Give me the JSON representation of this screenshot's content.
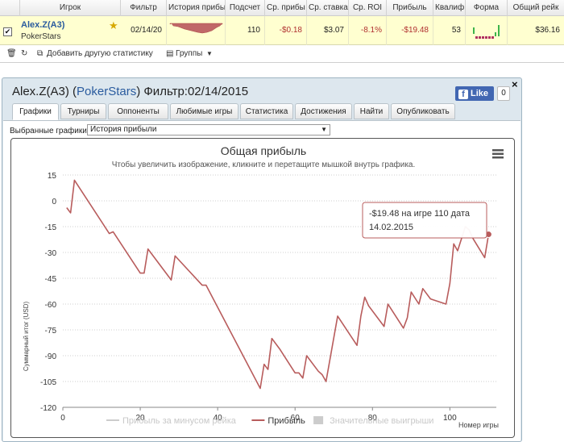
{
  "table": {
    "headers": [
      "Игрок",
      "Фильтр",
      "История прибыл",
      "Подсчет",
      "Ср. прибы",
      "Ср. ставка",
      "Ср. ROI",
      "Прибыль",
      "Квалиф",
      "Форма",
      "Общий рейк"
    ],
    "row": {
      "checked": "✔",
      "player": "Alex.Z(A3)",
      "site": "PokerStars",
      "filter": "02/14/20",
      "count": "110",
      "avg_profit": "-$0.18",
      "avg_stake": "$3.07",
      "avg_roi": "-8.1%",
      "profit": "-$19.48",
      "qual": "53",
      "total_rake": "$36.16"
    },
    "toolbar": {
      "add_stats": "Добавить другую статистику",
      "groups": "Группы"
    }
  },
  "popup": {
    "title_player": "Alex.Z(A3)",
    "title_site": "PokerStars",
    "title_filter": "Фильтр:02/14/2015",
    "fb_like": "Like",
    "fb_count": "0",
    "close": "×",
    "tabs": [
      "Графики",
      "Турниры",
      "Оппоненты",
      "Любимые игры",
      "Статистика",
      "Достижения",
      "Найти",
      "Опубликовать"
    ],
    "active_tab": 0,
    "selected_label": "Выбранные графики:",
    "selected_value": "История прибыли"
  },
  "chart_data": {
    "type": "line",
    "title": "Общая прибыль",
    "subtitle": "Чтобы увеличить изображение, кликните и перетащите мышкой внутрь графика.",
    "xlabel": "Номер игры",
    "ylabel": "Суммарный итог (USD)",
    "xlim": [
      0,
      112
    ],
    "ylim": [
      -120,
      15
    ],
    "xticks": [
      0,
      20,
      40,
      60,
      80,
      100
    ],
    "yticks": [
      15,
      0,
      -15,
      -30,
      -45,
      -60,
      -75,
      -90,
      -105,
      -120
    ],
    "grid": true,
    "legend_position": "bottom-center",
    "legend": [
      {
        "name": "Прибыль за минусом рейка",
        "color": "#cccccc",
        "visible": false
      },
      {
        "name": "Прибыль",
        "color": "#b85c5c",
        "visible": true
      },
      {
        "name": "Значительные выигрыши",
        "color": "#cccccc",
        "visible": false
      }
    ],
    "series": [
      {
        "name": "Прибыль",
        "color": "#b85c5c",
        "x": [
          1,
          2,
          3,
          12,
          13,
          20,
          21,
          22,
          28,
          29,
          36,
          37,
          51,
          52,
          53,
          54,
          56,
          60,
          61,
          62,
          63,
          66,
          67,
          68,
          71,
          76,
          77,
          78,
          79,
          83,
          84,
          88,
          89,
          90,
          92,
          93,
          95,
          99,
          100,
          101,
          102,
          104,
          105,
          106,
          109,
          110
        ],
        "y": [
          -4,
          -7,
          12,
          -19,
          -18,
          -42,
          -42,
          -28,
          -46,
          -32,
          -49,
          -49,
          -109,
          -95,
          -98,
          -80,
          -86,
          -100,
          -100,
          -103,
          -90,
          -99,
          -101,
          -105,
          -67,
          -84,
          -67,
          -56,
          -61,
          -73,
          -60,
          -74,
          -68,
          -53,
          -60,
          -51,
          -57,
          -60,
          -48,
          -25,
          -29,
          -15,
          -17,
          -22,
          -33,
          -19.48
        ]
      }
    ],
    "tooltip": {
      "text": "-$19.48 на игре 110 дата 14.02.2015",
      "game": 110,
      "value": -19.48
    }
  }
}
